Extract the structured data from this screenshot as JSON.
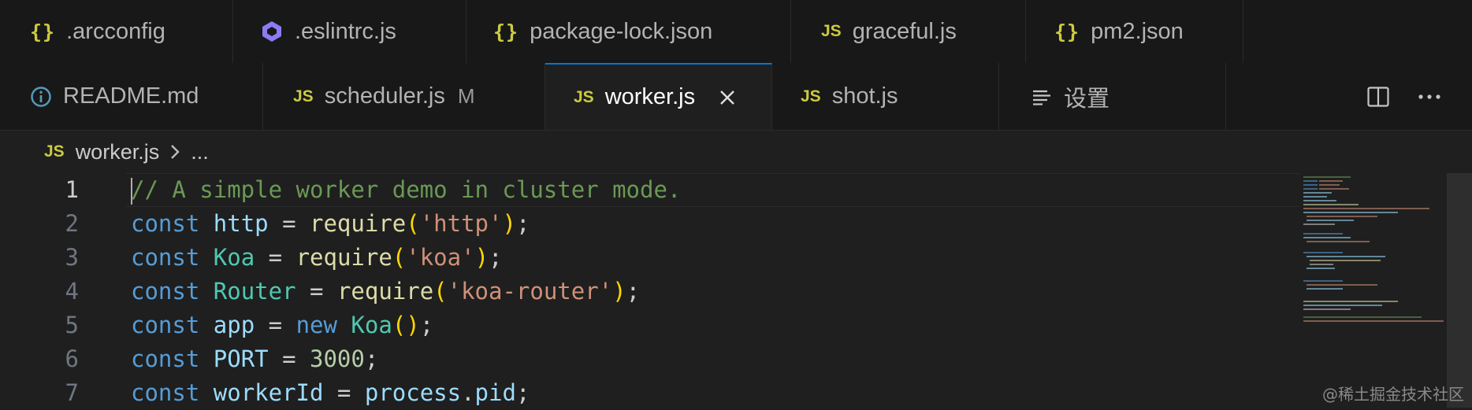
{
  "tabs_row1": [
    {
      "label": ".arcconfig",
      "icon": "json-braces-icon"
    },
    {
      "label": ".eslintrc.js",
      "icon": "eslint-icon"
    },
    {
      "label": "package-lock.json",
      "icon": "json-braces-icon"
    },
    {
      "label": "graceful.js",
      "icon": "js-icon"
    },
    {
      "label": "pm2.json",
      "icon": "json-braces-icon"
    }
  ],
  "tabs_row2": [
    {
      "label": "README.md",
      "icon": "info-icon"
    },
    {
      "label": "scheduler.js",
      "icon": "js-icon",
      "status": "M"
    },
    {
      "label": "worker.js",
      "icon": "js-icon",
      "active": true
    },
    {
      "label": "shot.js",
      "icon": "js-icon"
    },
    {
      "label": "设置",
      "icon": "settings-list-icon"
    }
  ],
  "icon_text": {
    "json": "{}",
    "js": "JS"
  },
  "breadcrumb": {
    "file": "worker.js",
    "more": "..."
  },
  "editor": {
    "line_numbers": [
      "1",
      "2",
      "3",
      "4",
      "5",
      "6",
      "7"
    ],
    "lines": [
      "// A simple worker demo in cluster mode.",
      "const http = require('http');",
      "const Koa = require('koa');",
      "const Router = require('koa-router');",
      "const app = new Koa();",
      "const PORT = 3000;",
      "const workerId = process.pid;"
    ]
  },
  "watermark": "@稀土掘金技术社区",
  "colors": {
    "accent": "#0078d4",
    "js_icon": "#cbcb41",
    "keyword": "#569cd6",
    "string": "#ce9178",
    "comment": "#6a9955"
  }
}
